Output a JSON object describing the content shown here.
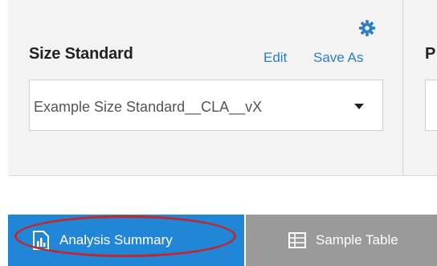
{
  "size_standard": {
    "title": "Size Standard",
    "edit_label": "Edit",
    "save_as_label": "Save As",
    "selected_value": "Example Size Standard__CLA__vX",
    "settings_icon": "gear-icon",
    "dropdown_icon": "caret-down-icon"
  },
  "next_section": {
    "title_fragment": "P"
  },
  "tabs": [
    {
      "label": "Analysis Summary",
      "icon": "report-chart-icon",
      "active": true
    },
    {
      "label": "Sample Table",
      "icon": "table-icon",
      "active": false
    }
  ],
  "colors": {
    "panel_bg": "#f3f3f3",
    "link": "#2a7fc9",
    "active_tab": "#2286d6",
    "inactive_tab": "#9a9a9a",
    "highlight": "#c1272d"
  }
}
